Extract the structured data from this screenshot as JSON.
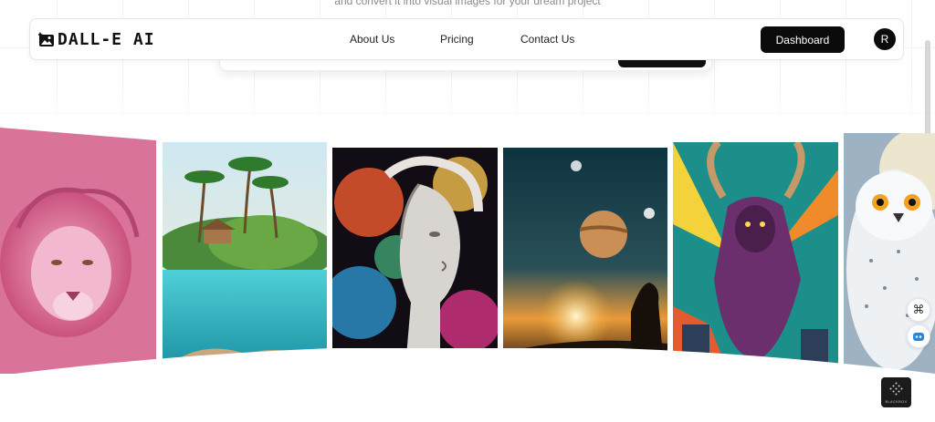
{
  "hero": {
    "subtitle": "and convert it into visual images for your dream project"
  },
  "navbar": {
    "logo_text": "DALL-E AI",
    "links": [
      {
        "label": "About Us"
      },
      {
        "label": "Pricing"
      },
      {
        "label": "Contact Us"
      }
    ],
    "dashboard_label": "Dashboard",
    "avatar_initial": "R"
  },
  "gallery": {
    "images": [
      {
        "subject": "pink-lion"
      },
      {
        "subject": "tropical-island"
      },
      {
        "subject": "colorful-goddess-statue"
      },
      {
        "subject": "space-sunset-silhouette"
      },
      {
        "subject": "comic-minotaur"
      },
      {
        "subject": "snowy-owl"
      }
    ]
  },
  "widgets": {
    "badge_text": "BLACKBOX"
  },
  "colors": {
    "primary": "#0b0b0b",
    "nav_text": "#222222",
    "lion_bg": "#d9739a"
  }
}
